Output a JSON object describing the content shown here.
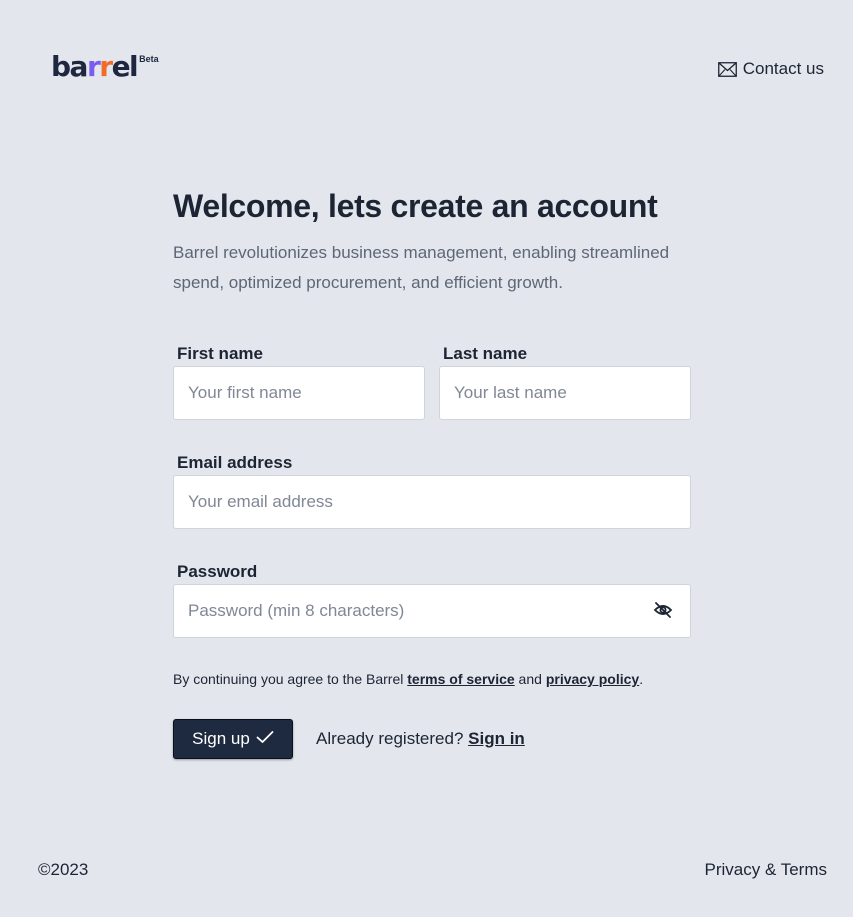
{
  "header": {
    "logo": {
      "part1": "ba",
      "part2": "r",
      "part3": "r",
      "part4": "el",
      "badge": "Beta"
    },
    "contact_label": "Contact us",
    "contact_icon": "mail-icon"
  },
  "main": {
    "title": "Welcome, lets create an account",
    "subtitle": "Barrel revolutionizes business management, enabling streamlined spend, optimized procurement, and efficient growth."
  },
  "form": {
    "first_name": {
      "label": "First name",
      "placeholder": "Your first name",
      "value": ""
    },
    "last_name": {
      "label": "Last name",
      "placeholder": "Your last name",
      "value": ""
    },
    "email": {
      "label": "Email address",
      "placeholder": "Your email address",
      "value": ""
    },
    "password": {
      "label": "Password",
      "placeholder": "Password (min 8 characters)",
      "value": "",
      "toggle_icon": "eye-off-icon"
    },
    "terms": {
      "prefix": "By continuing you agree to the Barrel ",
      "tos_link": "terms of service",
      "and": " and ",
      "privacy_link": "privacy policy",
      "suffix": "."
    },
    "signup_label": "Sign up",
    "signup_icon": "checkmark-icon",
    "already_text": "Already registered? ",
    "signin_link": "Sign in"
  },
  "footer": {
    "copyright": "©2023",
    "privacy_terms": "Privacy & Terms"
  },
  "colors": {
    "background": "#e3e7ed",
    "primary_button": "#1e2a3f",
    "logo_purple": "#7a5cf0",
    "logo_orange": "#f26b2a"
  }
}
